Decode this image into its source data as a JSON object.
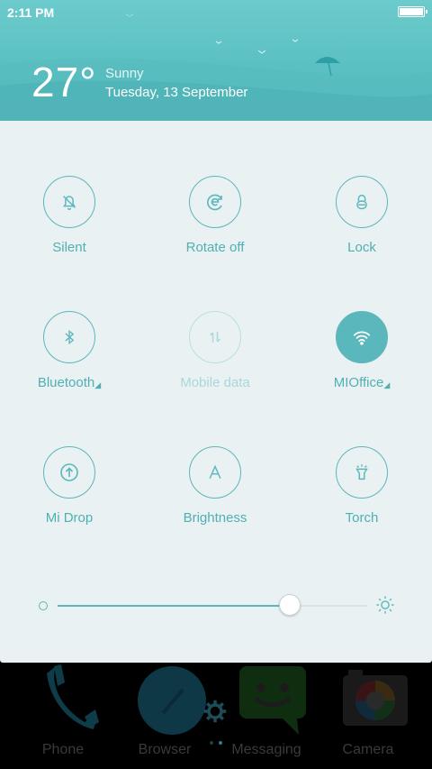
{
  "status_bar": {
    "time": "2:11 PM",
    "battery_icon": "battery-full-icon"
  },
  "weather": {
    "temperature": "27°",
    "condition": "Sunny",
    "date": "Tuesday, 13 September"
  },
  "toggles": [
    {
      "id": "silent",
      "label": "Silent",
      "icon": "bell-off-icon",
      "state": "off"
    },
    {
      "id": "rotate",
      "label": "Rotate off",
      "icon": "rotate-lock-icon",
      "state": "off"
    },
    {
      "id": "lock",
      "label": "Lock",
      "icon": "lock-icon",
      "state": "off"
    },
    {
      "id": "bluetooth",
      "label": "Bluetooth",
      "icon": "bluetooth-icon",
      "state": "off"
    },
    {
      "id": "mobile-data",
      "label": "Mobile data",
      "icon": "mobile-data-icon",
      "state": "disabled"
    },
    {
      "id": "wifi",
      "label": "MIOffice",
      "icon": "wifi-icon",
      "state": "on"
    },
    {
      "id": "mi-drop",
      "label": "Mi Drop",
      "icon": "upload-icon",
      "state": "off"
    },
    {
      "id": "brightness",
      "label": "Brightness",
      "icon": "auto-brightness-icon",
      "state": "off"
    },
    {
      "id": "torch",
      "label": "Torch",
      "icon": "flashlight-icon",
      "state": "off"
    }
  ],
  "brightness_slider": {
    "level": 0.75
  },
  "dock": [
    {
      "label": "Phone",
      "icon": "phone-icon"
    },
    {
      "label": "Browser",
      "icon": "browser-icon"
    },
    {
      "label": "Messaging",
      "icon": "messaging-icon"
    },
    {
      "label": "Camera",
      "icon": "camera-icon"
    }
  ],
  "colors": {
    "accent": "#5ab7bb",
    "panel": "#eaf1f3",
    "header": "#5ec2c4"
  }
}
